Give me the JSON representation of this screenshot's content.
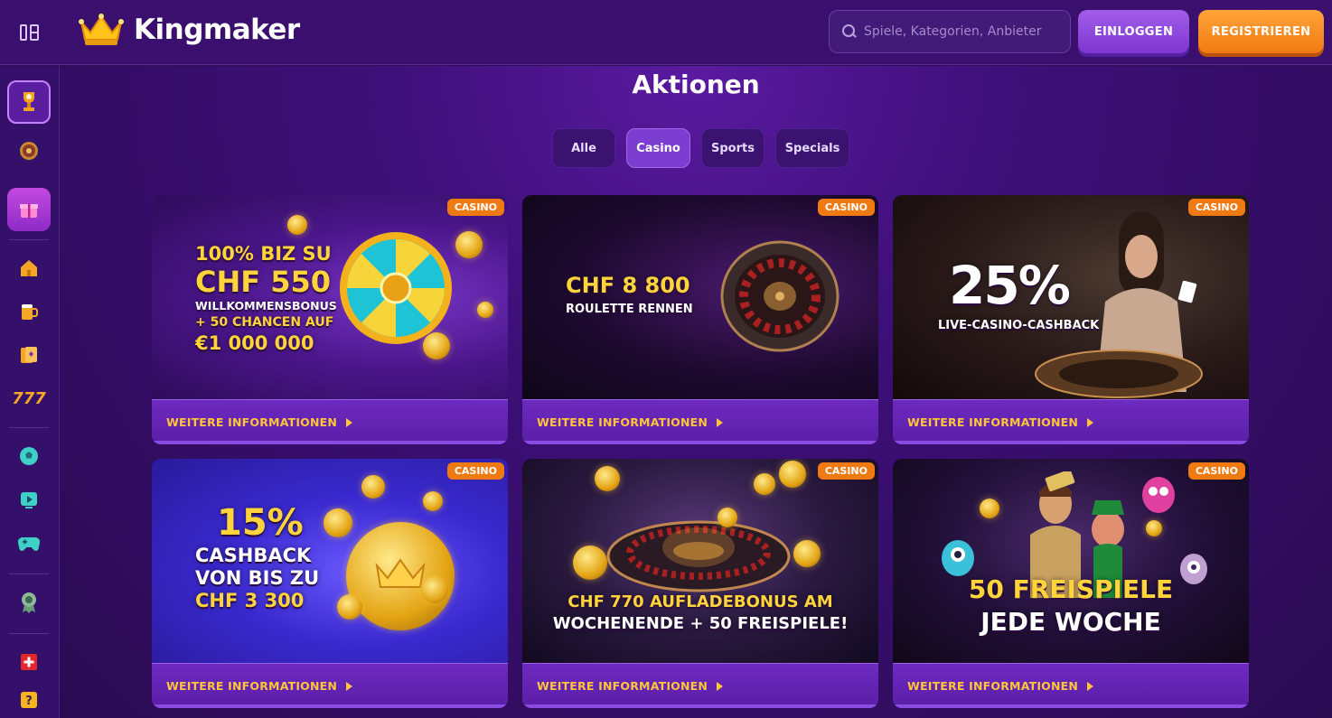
{
  "header": {
    "brand": "Kingmaker",
    "search_placeholder": "Spiele, Kategorien, Anbieter",
    "login_label": "EINLOGGEN",
    "register_label": "REGISTRIEREN"
  },
  "sidebar": {
    "items": [
      {
        "icon": "trophy-icon"
      },
      {
        "icon": "roulette-icon"
      },
      {
        "icon": "gift-icon"
      },
      {
        "icon": "home-icon"
      },
      {
        "icon": "beer-icon"
      },
      {
        "icon": "cards-icon"
      },
      {
        "icon": "slots-777-icon"
      },
      {
        "icon": "football-icon"
      },
      {
        "icon": "live-play-icon"
      },
      {
        "icon": "gamepad-icon"
      },
      {
        "icon": "badge-icon"
      },
      {
        "icon": "swiss-flag-icon"
      },
      {
        "icon": "help-icon"
      }
    ]
  },
  "main": {
    "title": "Aktionen",
    "tabs": [
      {
        "label": "Alle",
        "active": false
      },
      {
        "label": "Casino",
        "active": true
      },
      {
        "label": "Sports",
        "active": false
      },
      {
        "label": "Specials",
        "active": false
      }
    ],
    "more_label": "WEITERE INFORMATIONEN",
    "cards": [
      {
        "badge": "CASINO",
        "lines": [
          "100% BIZ SU",
          "CHF 550",
          "WILLKOMMENSBONUS",
          "+ 50 CHANCEN AUF",
          "€1 000 000"
        ]
      },
      {
        "badge": "CASINO",
        "lines": [
          "CHF 8 800",
          "ROULETTE RENNEN"
        ]
      },
      {
        "badge": "CASINO",
        "lines": [
          "25%",
          "LIVE-CASINO-CASHBACK"
        ]
      },
      {
        "badge": "CASINO",
        "lines": [
          "15%",
          "CASHBACK",
          "VON BIS ZU",
          "CHF 3 300"
        ]
      },
      {
        "badge": "CASINO",
        "lines": [
          "CHF 770 AUFLADEBONUS AM",
          "WOCHENENDE + 50 FREISPIELE!"
        ]
      },
      {
        "badge": "CASINO",
        "lines": [
          "50 FREISPIELE",
          "JEDE WOCHE"
        ]
      }
    ]
  },
  "colors": {
    "accent_orange": "#f07a12",
    "accent_purple": "#7b3ed0",
    "gold_text": "#ffc53a"
  }
}
